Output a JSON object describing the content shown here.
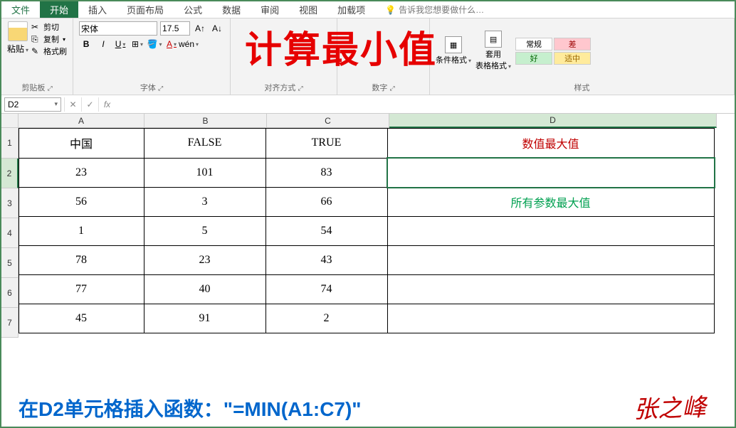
{
  "tabs": {
    "file": "文件",
    "home": "开始",
    "insert": "插入",
    "pagelayout": "页面布局",
    "formulas": "公式",
    "data": "数据",
    "review": "审阅",
    "view": "视图",
    "addins": "加载项",
    "tellme": "告诉我您想要做什么…"
  },
  "ribbon": {
    "clipboard": {
      "label": "剪贴板",
      "paste": "粘贴",
      "cut": "剪切",
      "copy": "复制",
      "format_painter": "格式刷"
    },
    "font": {
      "label": "字体",
      "name": "宋体",
      "size": "17.5",
      "bold": "B",
      "italic": "I",
      "underline": "U"
    },
    "alignment": {
      "label": "对齐方式"
    },
    "number": {
      "label": "数字"
    },
    "styles": {
      "label": "样式",
      "cond": "条件格式",
      "table": "套用\n表格格式",
      "normal": "常规",
      "bad": "差",
      "good": "好",
      "neutral": "适中"
    }
  },
  "overlay_title": "计算最小值",
  "formula_bar": {
    "namebox": "D2",
    "formula": ""
  },
  "columns": [
    "A",
    "B",
    "C",
    "D"
  ],
  "rows": [
    "1",
    "2",
    "3",
    "4",
    "5",
    "6",
    "7"
  ],
  "cells": {
    "A1": "中国",
    "B1": "FALSE",
    "C1": "TRUE",
    "D1": "数值最大值",
    "A2": "23",
    "B2": "101",
    "C2": "83",
    "D2": "",
    "A3": "56",
    "B3": "3",
    "C3": "66",
    "D3": "所有参数最大值",
    "A4": "1",
    "B4": "5",
    "C4": "54",
    "D4": "",
    "A5": "78",
    "B5": "23",
    "C5": "43",
    "D5": "",
    "A6": "77",
    "B6": "40",
    "C6": "74",
    "D6": "",
    "A7": "45",
    "B7": "91",
    "C7": "2",
    "D7": ""
  },
  "annotation": {
    "prefix": "在D2单元格插入函数：",
    "formula": "\"=MIN(A1:C7)\""
  },
  "signature": "张之峰"
}
